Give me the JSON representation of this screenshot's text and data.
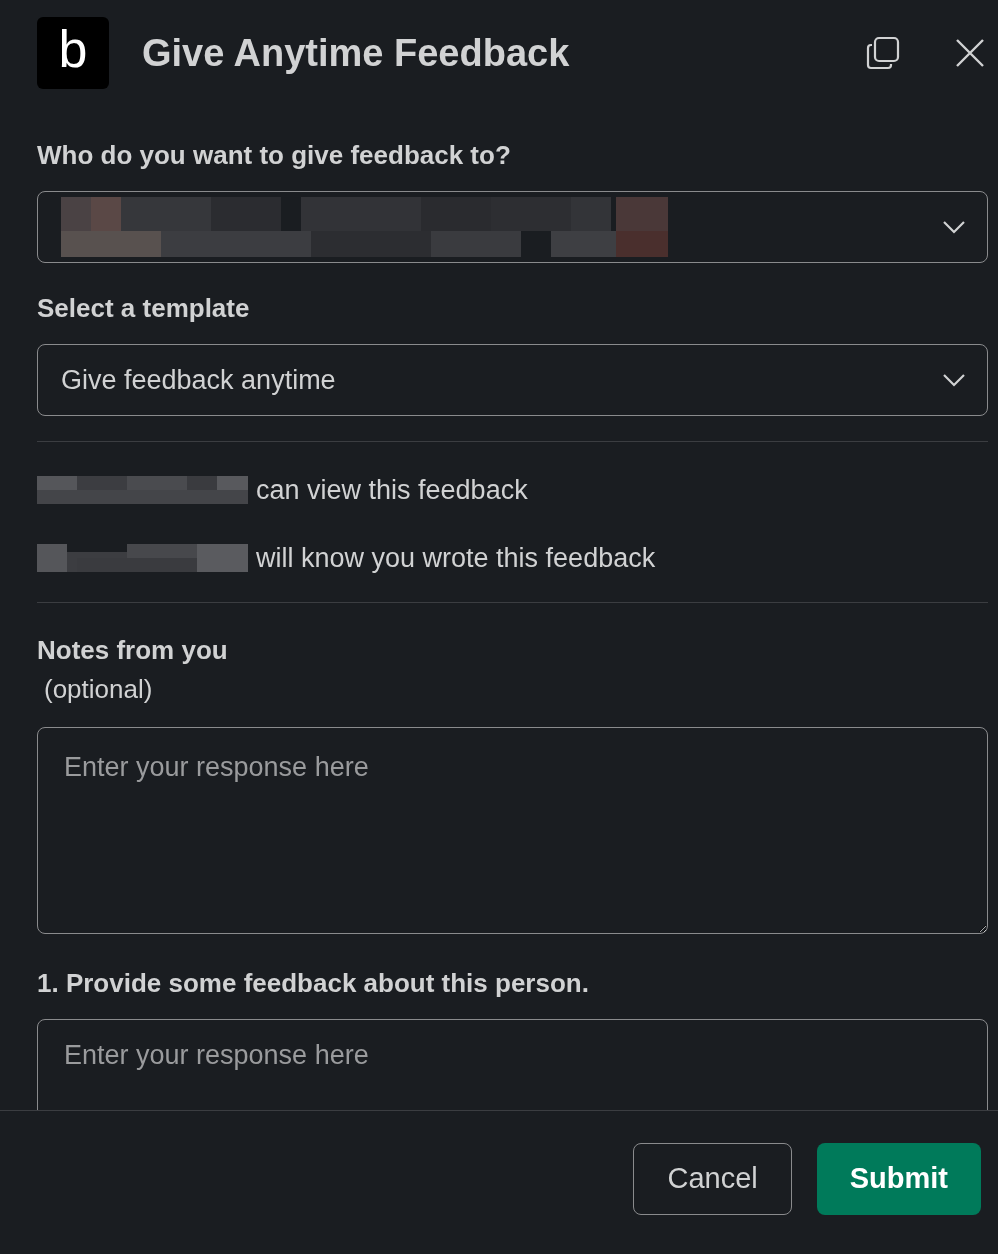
{
  "header": {
    "logo": "b",
    "title": "Give Anytime Feedback"
  },
  "recipient": {
    "label": "Who do you want to give feedback to?",
    "redacted": true
  },
  "template": {
    "label": "Select a template",
    "value": "Give feedback anytime"
  },
  "visibility": [
    {
      "text": "can view this feedback"
    },
    {
      "text": "will know you wrote this feedback"
    }
  ],
  "notes": {
    "label": "Notes from you",
    "hint": "(optional)",
    "placeholder": "Enter your response here"
  },
  "question": {
    "label": "1. Provide some feedback about this person.",
    "placeholder": "Enter your response here"
  },
  "buttons": [
    {
      "label": "Cancel",
      "kind": "secondary"
    },
    {
      "label": "Submit",
      "kind": "primary"
    }
  ]
}
